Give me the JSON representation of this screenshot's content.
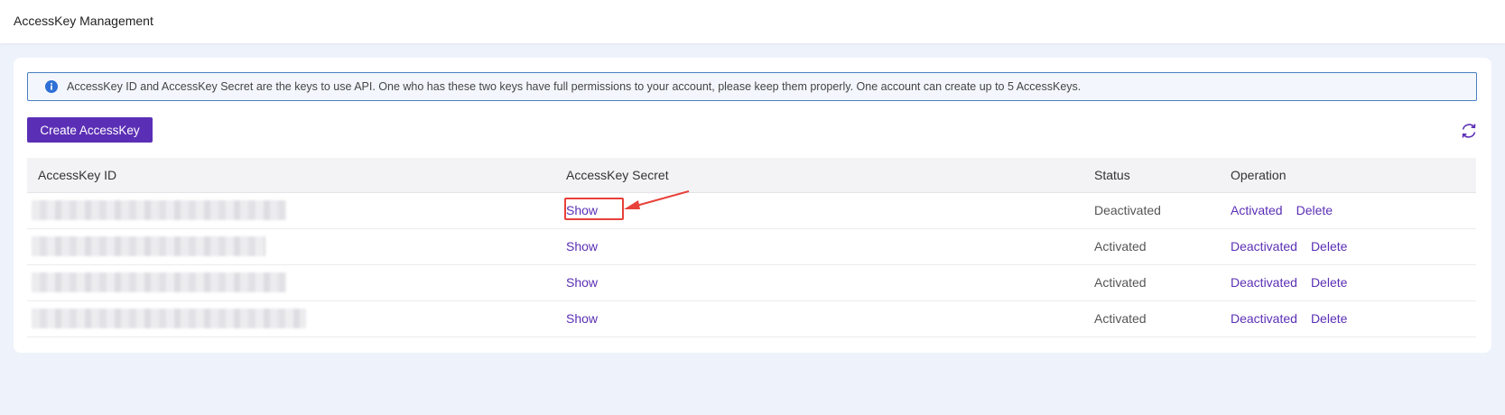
{
  "header": {
    "title": "AccessKey Management"
  },
  "notice": {
    "icon": "info-icon",
    "text": "AccessKey ID and AccessKey Secret are the keys to use API. One who has these two keys have full permissions to your account, please keep them properly. One account can create up to 5 AccessKeys."
  },
  "toolbar": {
    "create_label": "Create AccessKey",
    "refresh_icon": "refresh-icon"
  },
  "table": {
    "columns": [
      "AccessKey ID",
      "AccessKey Secret",
      "Status",
      "Operation"
    ],
    "rows": [
      {
        "secret_action": "Show",
        "status": "Deactivated",
        "toggle_action": "Activated",
        "delete_action": "Delete"
      },
      {
        "secret_action": "Show",
        "status": "Activated",
        "toggle_action": "Deactivated",
        "delete_action": "Delete"
      },
      {
        "secret_action": "Show",
        "status": "Activated",
        "toggle_action": "Deactivated",
        "delete_action": "Delete"
      },
      {
        "secret_action": "Show",
        "status": "Activated",
        "toggle_action": "Deactivated",
        "delete_action": "Delete"
      }
    ]
  },
  "colors": {
    "accent": "#5b2fb5",
    "annotation": "#e8403a",
    "notice_border": "#4a7fc1"
  }
}
